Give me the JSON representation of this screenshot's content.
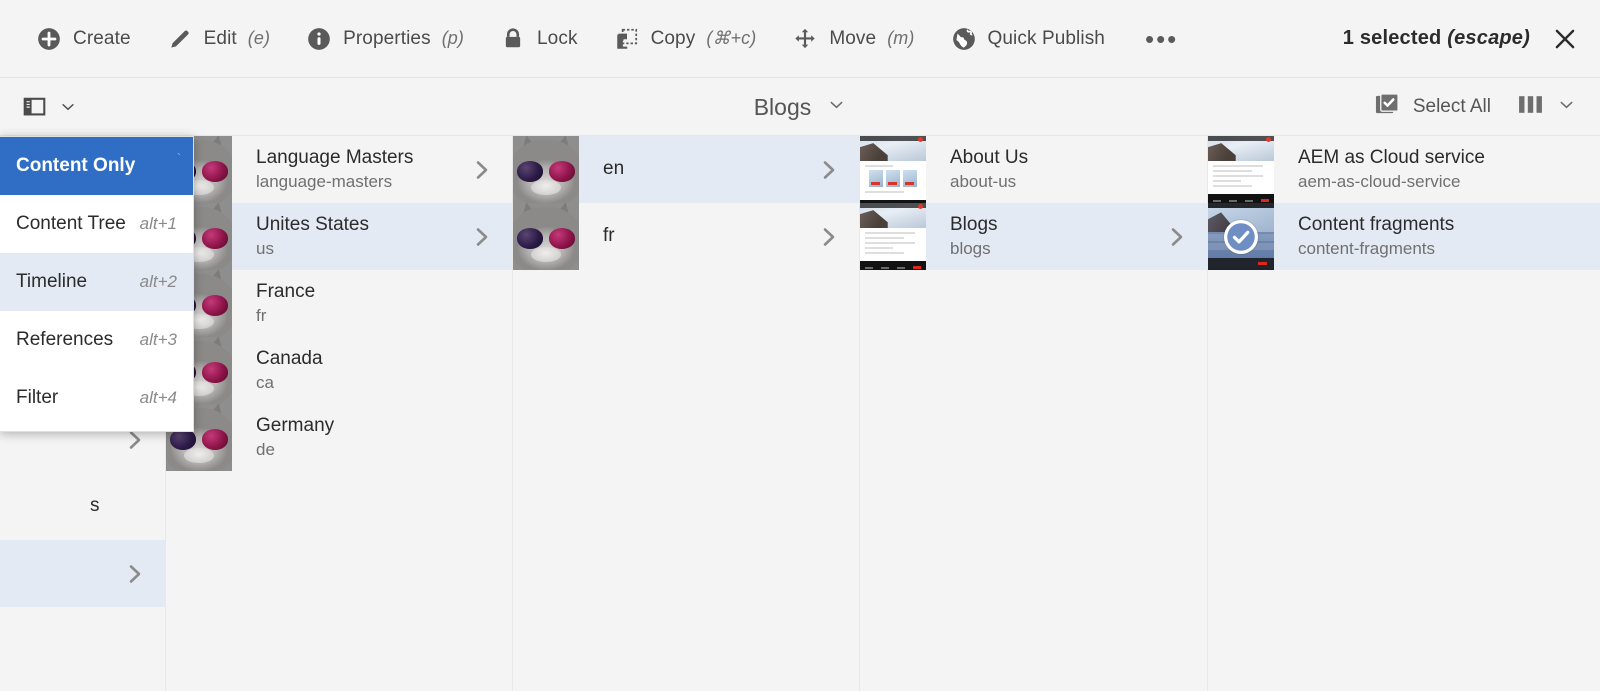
{
  "actionbar": {
    "items": [
      {
        "label": "Create",
        "shortcut": "",
        "icon": "add-circle-icon"
      },
      {
        "label": "Edit",
        "shortcut": "(e)",
        "icon": "pencil-icon"
      },
      {
        "label": "Properties",
        "shortcut": "(p)",
        "icon": "info-circle-icon"
      },
      {
        "label": "Lock",
        "shortcut": "",
        "icon": "lock-icon"
      },
      {
        "label": "Copy",
        "shortcut": "(⌘+c)",
        "icon": "copy-icon"
      },
      {
        "label": "Move",
        "shortcut": "(m)",
        "icon": "move-icon"
      },
      {
        "label": "Quick Publish",
        "shortcut": "",
        "icon": "globe-icon"
      }
    ],
    "more_label": "•••",
    "selection_text": "1 selected",
    "selection_hint": "(escape)",
    "close_icon": "close-icon"
  },
  "subbar": {
    "rail_icon": "rail-panel-icon",
    "rail_chevron": "chevron-down-icon",
    "title": "Blogs",
    "title_chevron": "chevron-down-icon",
    "select_all_label": "Select All",
    "select_all_icon": "checkbox-checked-icon",
    "view_icon": "column-view-icon",
    "view_chevron": "chevron-down-icon"
  },
  "rail_menu": {
    "items": [
      {
        "label": "Content Only",
        "shortcut": "",
        "state": "active"
      },
      {
        "label": "Content Tree",
        "shortcut": "alt+1",
        "state": "normal"
      },
      {
        "label": "Timeline",
        "shortcut": "alt+2",
        "state": "highlight"
      },
      {
        "label": "References",
        "shortcut": "alt+3",
        "state": "normal"
      },
      {
        "label": "Filter",
        "shortcut": "alt+4",
        "state": "normal"
      }
    ]
  },
  "columns": [
    {
      "id": "col-1",
      "rows": [
        {
          "title": "",
          "subtitle": "",
          "thumb": "none",
          "state": "normal",
          "chevron": false,
          "spacer_h": 270
        },
        {
          "title": "",
          "subtitle": "",
          "thumb": "none",
          "state": "normal",
          "chevron": true
        },
        {
          "title": "s",
          "subtitle": "",
          "thumb": "none",
          "state": "normal",
          "chevron": false
        },
        {
          "title": "",
          "subtitle": "",
          "thumb": "none",
          "state": "selected",
          "chevron": true
        }
      ]
    },
    {
      "id": "col-2",
      "rows": [
        {
          "title": "Language Masters",
          "subtitle": "language-masters",
          "thumb": "cat",
          "state": "normal",
          "chevron": true
        },
        {
          "title": "Unites States",
          "subtitle": "us",
          "thumb": "cat",
          "state": "selected",
          "chevron": true
        },
        {
          "title": "France",
          "subtitle": "fr",
          "thumb": "cat",
          "state": "normal",
          "chevron": false
        },
        {
          "title": "Canada",
          "subtitle": "ca",
          "thumb": "cat",
          "state": "normal",
          "chevron": false
        },
        {
          "title": "Germany",
          "subtitle": "de",
          "thumb": "cat",
          "state": "normal",
          "chevron": false
        }
      ]
    },
    {
      "id": "col-3",
      "rows": [
        {
          "title": "en",
          "subtitle": "",
          "thumb": "cat",
          "state": "selected",
          "chevron": true
        },
        {
          "title": "fr",
          "subtitle": "",
          "thumb": "cat",
          "state": "normal",
          "chevron": true
        }
      ]
    },
    {
      "id": "col-4",
      "rows": [
        {
          "title": "About Us",
          "subtitle": "about-us",
          "thumb": "page",
          "state": "normal",
          "chevron": false
        },
        {
          "title": "Blogs",
          "subtitle": "blogs",
          "thumb": "page2",
          "state": "selected",
          "chevron": true
        }
      ]
    },
    {
      "id": "col-5",
      "rows": [
        {
          "title": "AEM as Cloud service",
          "subtitle": "aem-as-cloud-service",
          "thumb": "page3",
          "state": "normal",
          "chevron": false
        },
        {
          "title": "Content fragments",
          "subtitle": "content-fragments",
          "thumb": "blue",
          "state": "selected",
          "chevron": false,
          "checked": true
        }
      ]
    }
  ],
  "colors": {
    "accent_blue": "#2f6ec4",
    "row_selected": "#e4eaf3",
    "surface": "#f4f4f4",
    "text_primary": "#2b2b2b",
    "text_secondary": "#707070"
  }
}
